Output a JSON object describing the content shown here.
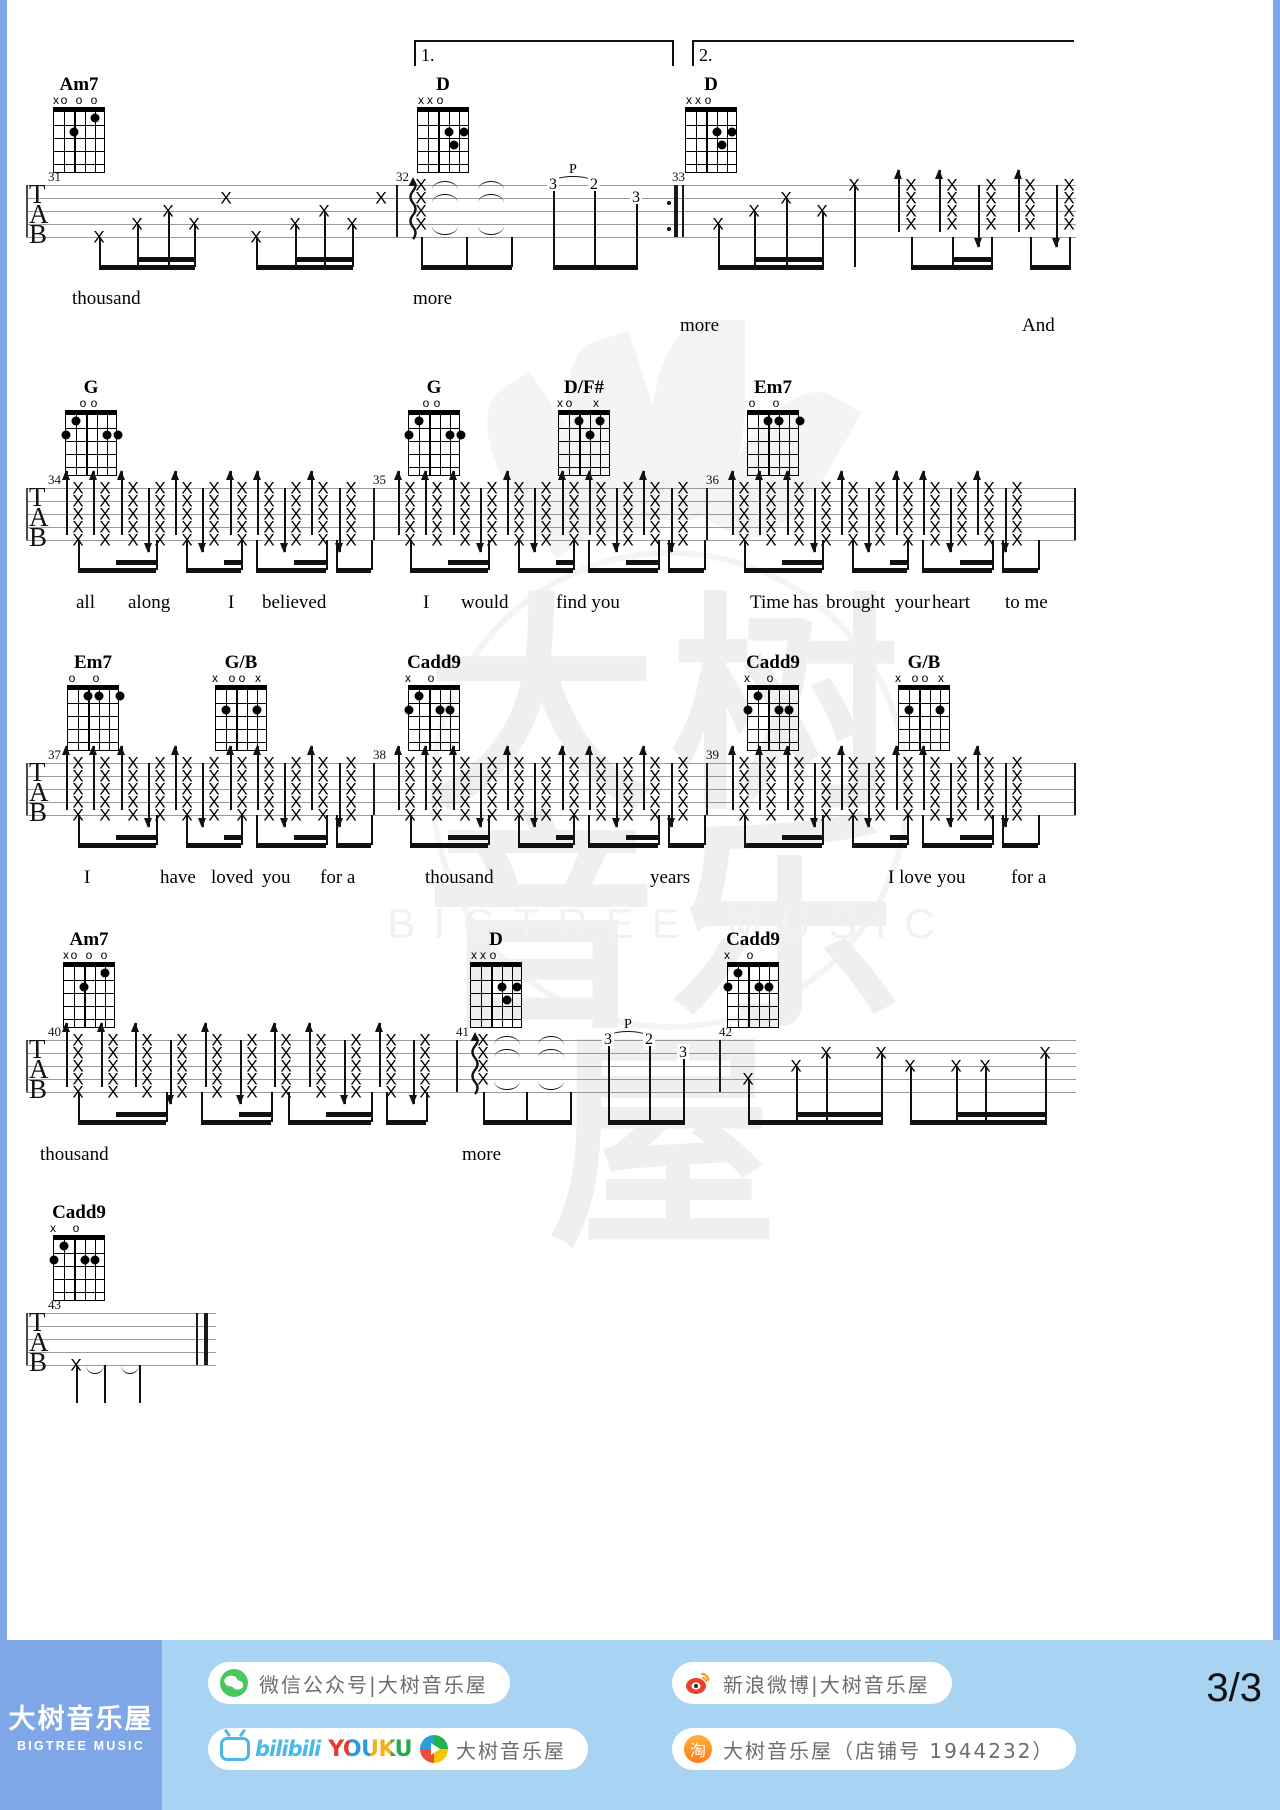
{
  "page": {
    "number_label": "3/3",
    "title_hidden": ""
  },
  "watermark": {
    "text": "大树音乐屋",
    "subtext": "BIGTREE MUSIC"
  },
  "systems": [
    {
      "id": "system-1",
      "measures": [
        "31",
        "32",
        "33"
      ],
      "chords": [
        {
          "name": "Am7",
          "open": "xo o o"
        },
        {
          "name": "D",
          "open": "xxo"
        },
        {
          "name": "D",
          "open": "xxo"
        }
      ],
      "endings": [
        {
          "label": "1."
        },
        {
          "label": "2."
        }
      ],
      "tab_label": "TAB",
      "technique": "P",
      "fret_numbers": [
        "3",
        "2",
        "3"
      ],
      "lyrics": [
        "thousand",
        "more",
        "more",
        "And"
      ]
    },
    {
      "id": "system-2",
      "measures": [
        "34",
        "35",
        "36"
      ],
      "chords": [
        {
          "name": "G",
          "open": "oo"
        },
        {
          "name": "G",
          "open": "oo"
        },
        {
          "name": "D/F#",
          "open": "xo  x"
        },
        {
          "name": "Em7",
          "open": "o  o"
        }
      ],
      "tab_label": "TAB",
      "lyrics": [
        "all",
        "along",
        "I",
        "believed",
        "I",
        "would",
        "find you",
        "Time",
        "has",
        "brought",
        "your",
        "heart",
        "to me"
      ]
    },
    {
      "id": "system-3",
      "measures": [
        "37",
        "38",
        "39"
      ],
      "chords": [
        {
          "name": "Em7",
          "open": "o  o"
        },
        {
          "name": "G/B",
          "open": "x oo x"
        },
        {
          "name": "Cadd9",
          "open": "x  o"
        },
        {
          "name": "Cadd9",
          "open": "x  o"
        },
        {
          "name": "G/B",
          "open": "x oo x"
        }
      ],
      "tab_label": "TAB",
      "lyrics": [
        "I",
        "have",
        "loved",
        "you",
        "for a",
        "thousand",
        "years",
        "I love",
        "you",
        "for a"
      ]
    },
    {
      "id": "system-4",
      "measures": [
        "40",
        "41",
        "42"
      ],
      "chords": [
        {
          "name": "Am7",
          "open": "xo o o"
        },
        {
          "name": "D",
          "open": "xxo"
        },
        {
          "name": "Cadd9",
          "open": "x  o"
        }
      ],
      "tab_label": "TAB",
      "technique": "P",
      "fret_numbers": [
        "3",
        "2",
        "3"
      ],
      "lyrics": [
        "thousand",
        "more"
      ]
    },
    {
      "id": "system-5",
      "measures": [
        "43"
      ],
      "chords": [
        {
          "name": "Cadd9",
          "open": "x  o"
        }
      ],
      "tab_label": "TAB",
      "lyrics": []
    }
  ],
  "footer": {
    "brand_cn": "大树音乐屋",
    "brand_en": "BIGTREE MUSIC",
    "pills": [
      {
        "icon": "wechat-icon",
        "text": "微信公众号|大树音乐屋"
      },
      {
        "icon": "bilibili-youku-icon",
        "text": "大树音乐屋"
      },
      {
        "icon": "weibo-icon",
        "text": "新浪微博|大树音乐屋"
      },
      {
        "icon": "taobao-icon",
        "text": "大树音乐屋（店铺号 1944232）"
      }
    ],
    "bilibili_label": "bilibili",
    "youku_label": "YOUKU",
    "page_number": "3/3"
  }
}
